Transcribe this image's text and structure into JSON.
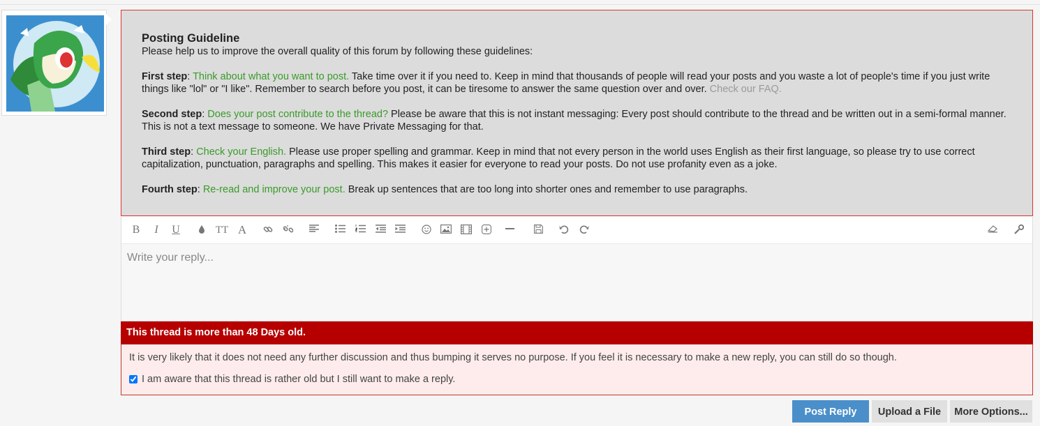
{
  "guideline": {
    "title": "Posting Guideline",
    "intro": "Please help us to improve the overall quality of this forum by following these guidelines:",
    "steps": [
      {
        "label": "First step",
        "sep": ": ",
        "highlight": "Think about what you want to post.",
        "text": " Take time over it if you need to. Keep in mind that thousands of people will read your posts and you waste a lot of people's time if you just write things like \"lol\" or \"I like\". Remember to search before you post, it can be tiresome to answer the same question over and over. ",
        "link": "Check our FAQ."
      },
      {
        "label": "Second step",
        "sep": ": ",
        "highlight": "Does your post contribute to the thread?",
        "text": " Please be aware that this is not instant messaging: Every post should contribute to the thread and be written out in a semi-formal manner. This is not a text message to someone. We have Private Messaging for that."
      },
      {
        "label": "Third step",
        "sep": ": ",
        "highlight": "Check your English.",
        "text": " Please use proper spelling and grammar. Keep in mind that not every person in the world uses English as their first language, so please try to use correct capitalization, punctuation, paragraphs and spelling. This makes it easier for everyone to read your posts. Do not use profanity even as a joke."
      },
      {
        "label": "Fourth step",
        "sep": ": ",
        "highlight": "Re-read and improve your post.",
        "text": " Break up sentences that are too long into shorter ones and remember to use paragraphs."
      }
    ]
  },
  "toolbar": {
    "bold": "B",
    "italic": "I",
    "underline": "U",
    "size": "TT",
    "font": "A"
  },
  "editor": {
    "placeholder": "Write your reply..."
  },
  "warning": {
    "title": "This thread is more than 48 Days old.",
    "message": "It is very likely that it does not need any further discussion and thus bumping it serves no purpose. If you feel it is necessary to make a new reply, you can still do so though.",
    "checkbox_label": "I am aware that this thread is rather old but I still want to make a reply.",
    "checkbox_checked": true
  },
  "buttons": {
    "post_reply": "Post Reply",
    "upload_file": "Upload a File",
    "more_options": "More Options..."
  },
  "colors": {
    "accent_blue": "#4a8fc9",
    "warning_red": "#b60000",
    "guideline_green": "#3a9a2a"
  }
}
